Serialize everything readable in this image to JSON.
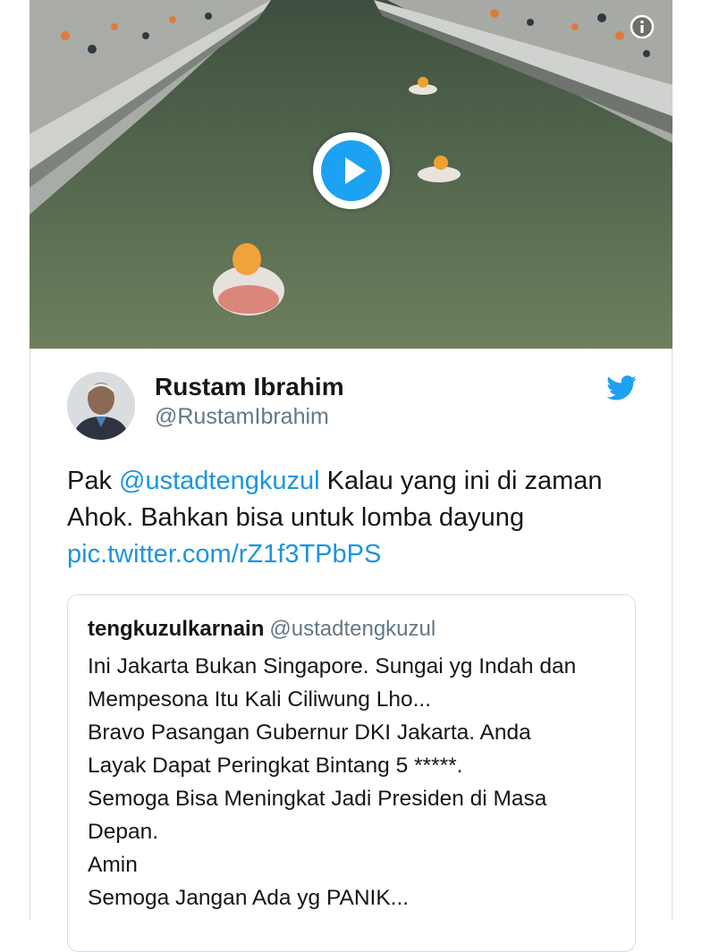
{
  "media": {
    "play_icon": "play-icon",
    "info_icon": "info-icon"
  },
  "tweet": {
    "author_name": "Rustam Ibrahim",
    "author_handle": "@RustamIbrahim",
    "brand_icon": "twitter-bird-icon",
    "brand_color": "#1da1f2",
    "text_prefix": "Pak ",
    "mention": "@ustadtengkuzul",
    "text_line1_rest": " Kalau yang ini di zaman",
    "text_line2": "Ahok. Bahkan bisa untuk lomba dayung",
    "pic_link": "pic.twitter.com/rZ1f3TPbPS"
  },
  "quoted_tweet": {
    "name": "tengkuzulkarnain",
    "handle": "@ustadtengkuzul",
    "lines": [
      "Ini Jakarta Bukan Singapore. Sungai yg Indah dan",
      "Mempesona Itu Kali Ciliwung Lho...",
      "Bravo Pasangan Gubernur DKI Jakarta. Anda",
      "Layak Dapat Peringkat Bintang 5 *****.",
      "Semoga Bisa Meningkat Jadi Presiden di Masa",
      "Depan.",
      "Amin",
      "Semoga Jangan Ada yg PANIK..."
    ]
  }
}
